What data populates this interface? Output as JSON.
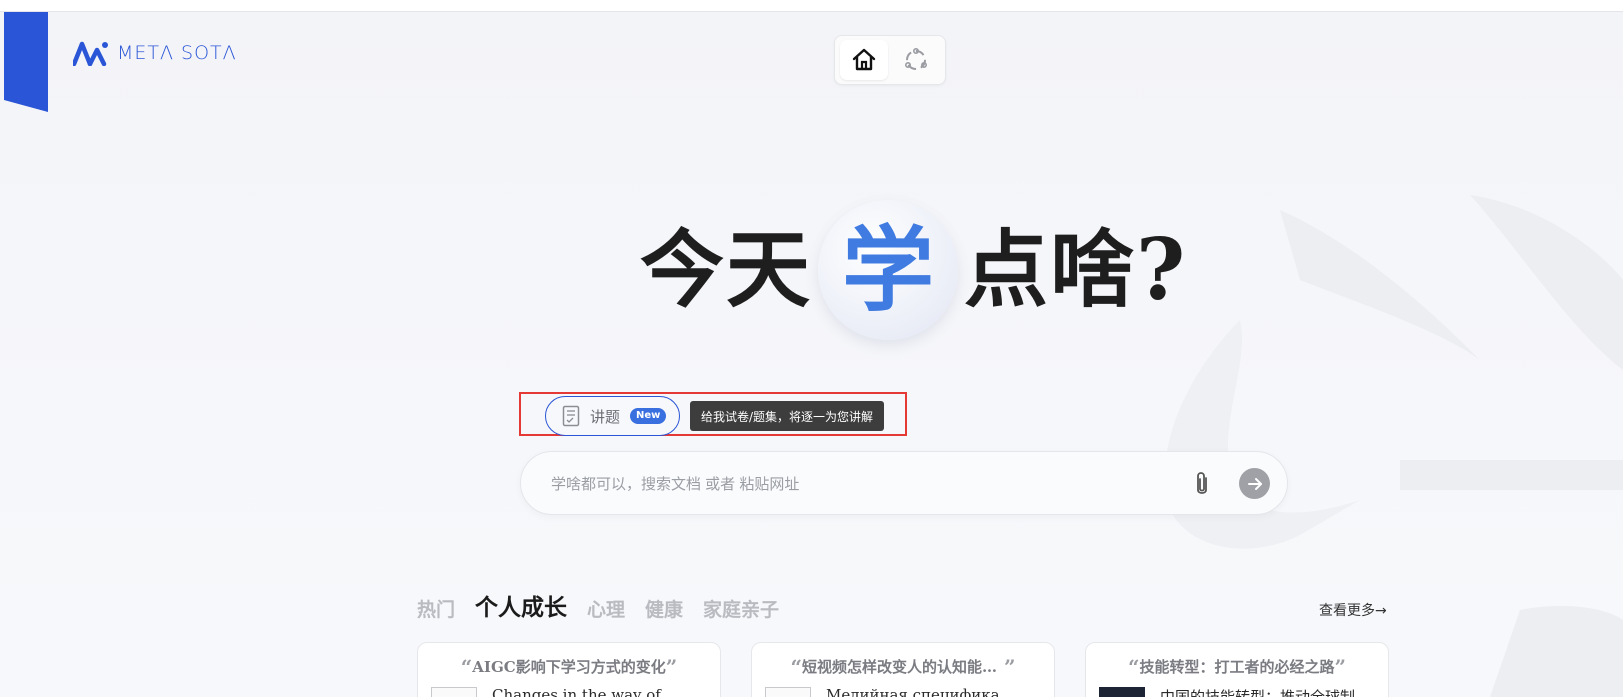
{
  "brand": {
    "name": "METΛ SOTΛ",
    "accent_color": "#2a55d6"
  },
  "top_nav": {
    "items": [
      {
        "icon": "home-icon",
        "active": true
      },
      {
        "icon": "community-icon",
        "active": false
      }
    ]
  },
  "hero": {
    "before": "今天",
    "highlight": "学",
    "after": "点啥?",
    "highlight_color": "#3f7be0"
  },
  "mode": {
    "icon": "exam-paper-icon",
    "label": "讲题",
    "badge": "New",
    "tooltip": "给我试卷/题集，将逐一为您讲解"
  },
  "search": {
    "placeholder": "学啥都可以，搜索文档 或者 粘贴网址",
    "value": "",
    "attach_icon": "paperclip-icon",
    "send_icon": "arrow-right-icon"
  },
  "topics": {
    "tabs": [
      {
        "label": "热门",
        "active": false
      },
      {
        "label": "个人成长",
        "active": true
      },
      {
        "label": "心理",
        "active": false
      },
      {
        "label": "健康",
        "active": false
      },
      {
        "label": "家庭亲子",
        "active": false
      }
    ],
    "see_more": "查看更多→"
  },
  "cards": [
    {
      "title": "AIGC影响下学习方式的变化",
      "preview": "Changes in the way of"
    },
    {
      "title": "短视频怎样改变人的认知能…",
      "preview": "Медийная специфика"
    },
    {
      "title": "技能转型：打工者的必经之路",
      "preview": "中国的技能转型：推动全球制"
    }
  ]
}
